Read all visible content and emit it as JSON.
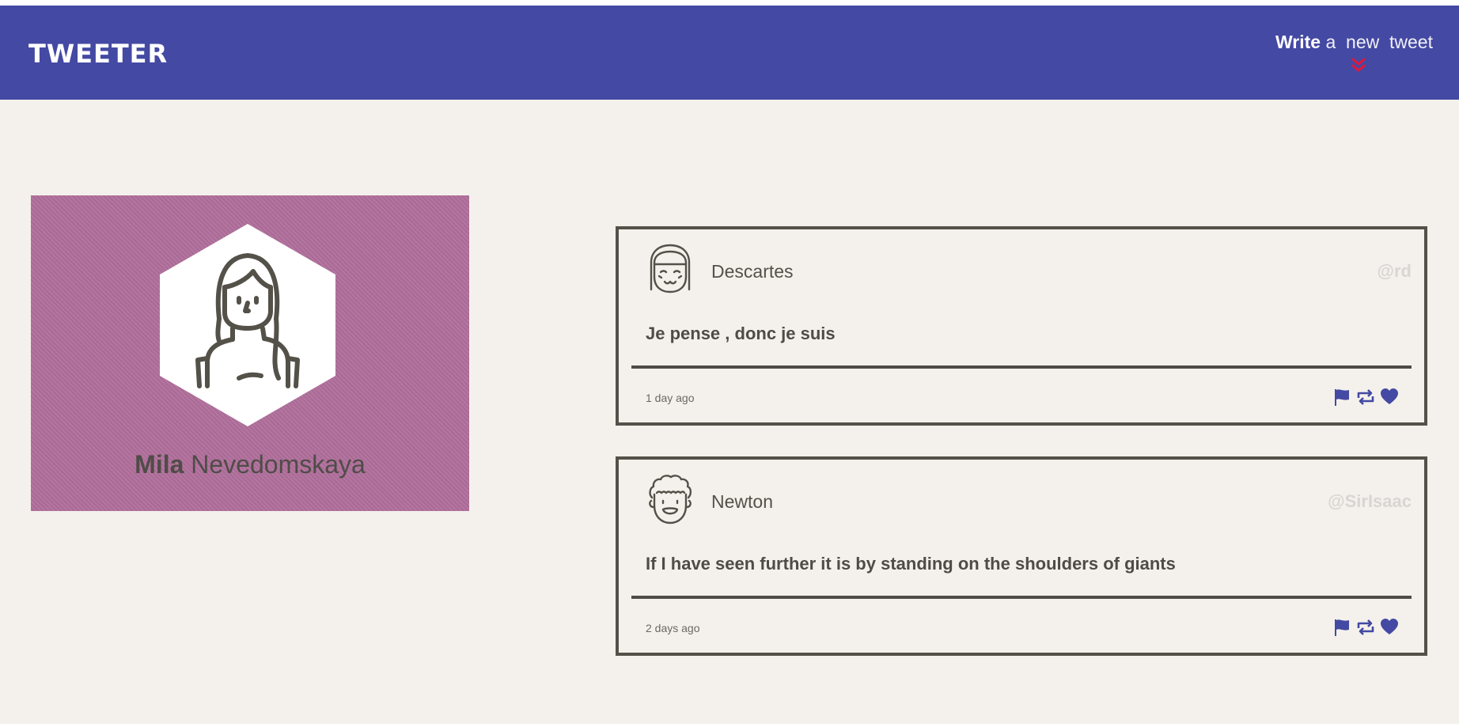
{
  "app": {
    "logo": "TWEETER",
    "compose": {
      "word1": "Write",
      "word2": "a",
      "word3": "new",
      "word4": "tweet"
    }
  },
  "icons": {
    "compose_toggle": "chevron-double-down-icon",
    "flag": "flag-icon",
    "retweet": "retweet-icon",
    "like": "heart-icon"
  },
  "colors": {
    "navbar": "#4449a3",
    "accent": "#e0173b",
    "profile_bg": "#b06f9b",
    "page_bg": "#f4f1ec",
    "text": "#545149",
    "action_icons": "#4449a3"
  },
  "profile": {
    "first_name": "Mila",
    "last_name": "Nevedomskaya"
  },
  "tweets": [
    {
      "author": "Descartes",
      "handle": "@rd",
      "content": "Je pense , donc je suis",
      "time": "1 day ago"
    },
    {
      "author": "Newton",
      "handle": "@SirIsaac",
      "content": "If I have seen further it is by standing on the shoulders of giants",
      "time": "2 days ago"
    }
  ]
}
